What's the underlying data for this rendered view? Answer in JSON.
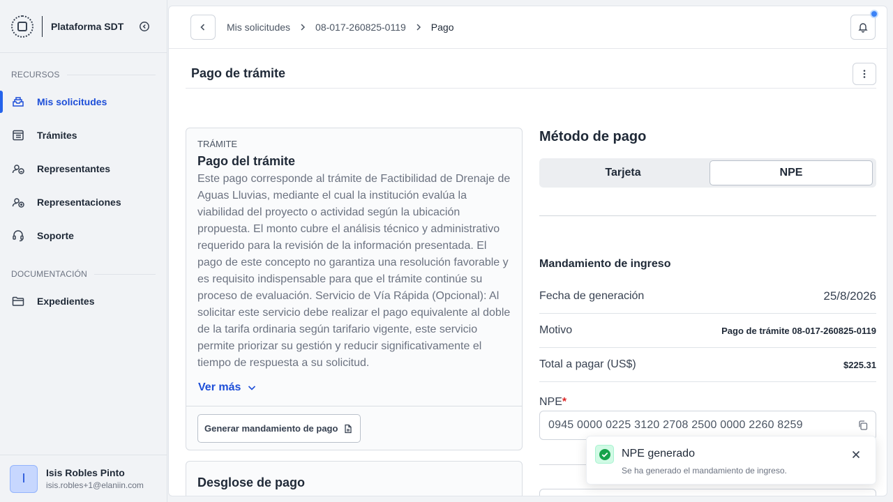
{
  "app": {
    "name": "Plataforma SDT"
  },
  "sidebar": {
    "section_resources": "RECURSOS",
    "resources": [
      {
        "label": "Mis solicitudes",
        "icon": "inbox-icon",
        "active": true
      },
      {
        "label": "Trámites",
        "icon": "list-icon"
      },
      {
        "label": "Representantes",
        "icon": "users-icon"
      },
      {
        "label": "Representaciones",
        "icon": "users-icon"
      },
      {
        "label": "Soporte",
        "icon": "headset-icon"
      }
    ],
    "section_docs": "DOCUMENTACIÓN",
    "docs": [
      {
        "label": "Expedientes",
        "icon": "folder-icon"
      }
    ]
  },
  "user": {
    "initial": "I",
    "name": "Isis Robles Pinto",
    "email": "isis.robles+1@elaniin.com"
  },
  "breadcrumb": {
    "items": [
      "Mis solicitudes",
      "08-017-260825-0119",
      "Pago"
    ]
  },
  "page": {
    "title": "Pago de trámite"
  },
  "procedure_card": {
    "eyebrow": "TRÁMITE",
    "title": "Pago del trámite",
    "description": "Este pago corresponde al trámite de Factibilidad de Drenaje de Aguas Lluvias, mediante el cual la institución evalúa la viabilidad del proyecto o actividad según la ubicación propuesta. El monto cubre el análisis técnico y administrativo requerido para la revisión de la información presentada. El pago de este concepto no garantiza una resolución favorable y es requisito indispensable para que el trámite continúe su proceso de evaluación. Servicio de Vía Rápida (Opcional): Al solicitar este servicio debe realizar el pago equivalente al doble de la tarifa ordinaria según tarifario vigente, este servicio permite priorizar su gestión y reducir significativamente el tiempo de respuesta a su solicitud.",
    "see_more": "Ver más",
    "generate_button": "Generar mandamiento de pago"
  },
  "breakdown_card": {
    "title": "Desglose de pago"
  },
  "payment": {
    "title": "Método de pago",
    "options": [
      "Tarjeta",
      "NPE"
    ],
    "selected": "NPE",
    "order_title": "Mandamiento de ingreso",
    "rows": [
      {
        "label": "Fecha de generación",
        "value": "25/8/2026"
      },
      {
        "label": "Motivo",
        "value": "Pago de trámite 08-017-260825-0119"
      },
      {
        "label": "Total a pagar (US$)",
        "value": "$225.31"
      }
    ],
    "npe_label": "NPE",
    "npe_required_mark": "*",
    "npe_value": "0945 0000 0225 3120 2708 2500 0000 2260 8259"
  },
  "toast": {
    "title": "NPE generado",
    "message": "Se ha generado el mandamiento de ingreso.",
    "color": "#16a34a"
  },
  "colors": {
    "accent": "#1d4ed8",
    "notification_dot": "#3b82f6",
    "required": "#dc2626"
  }
}
